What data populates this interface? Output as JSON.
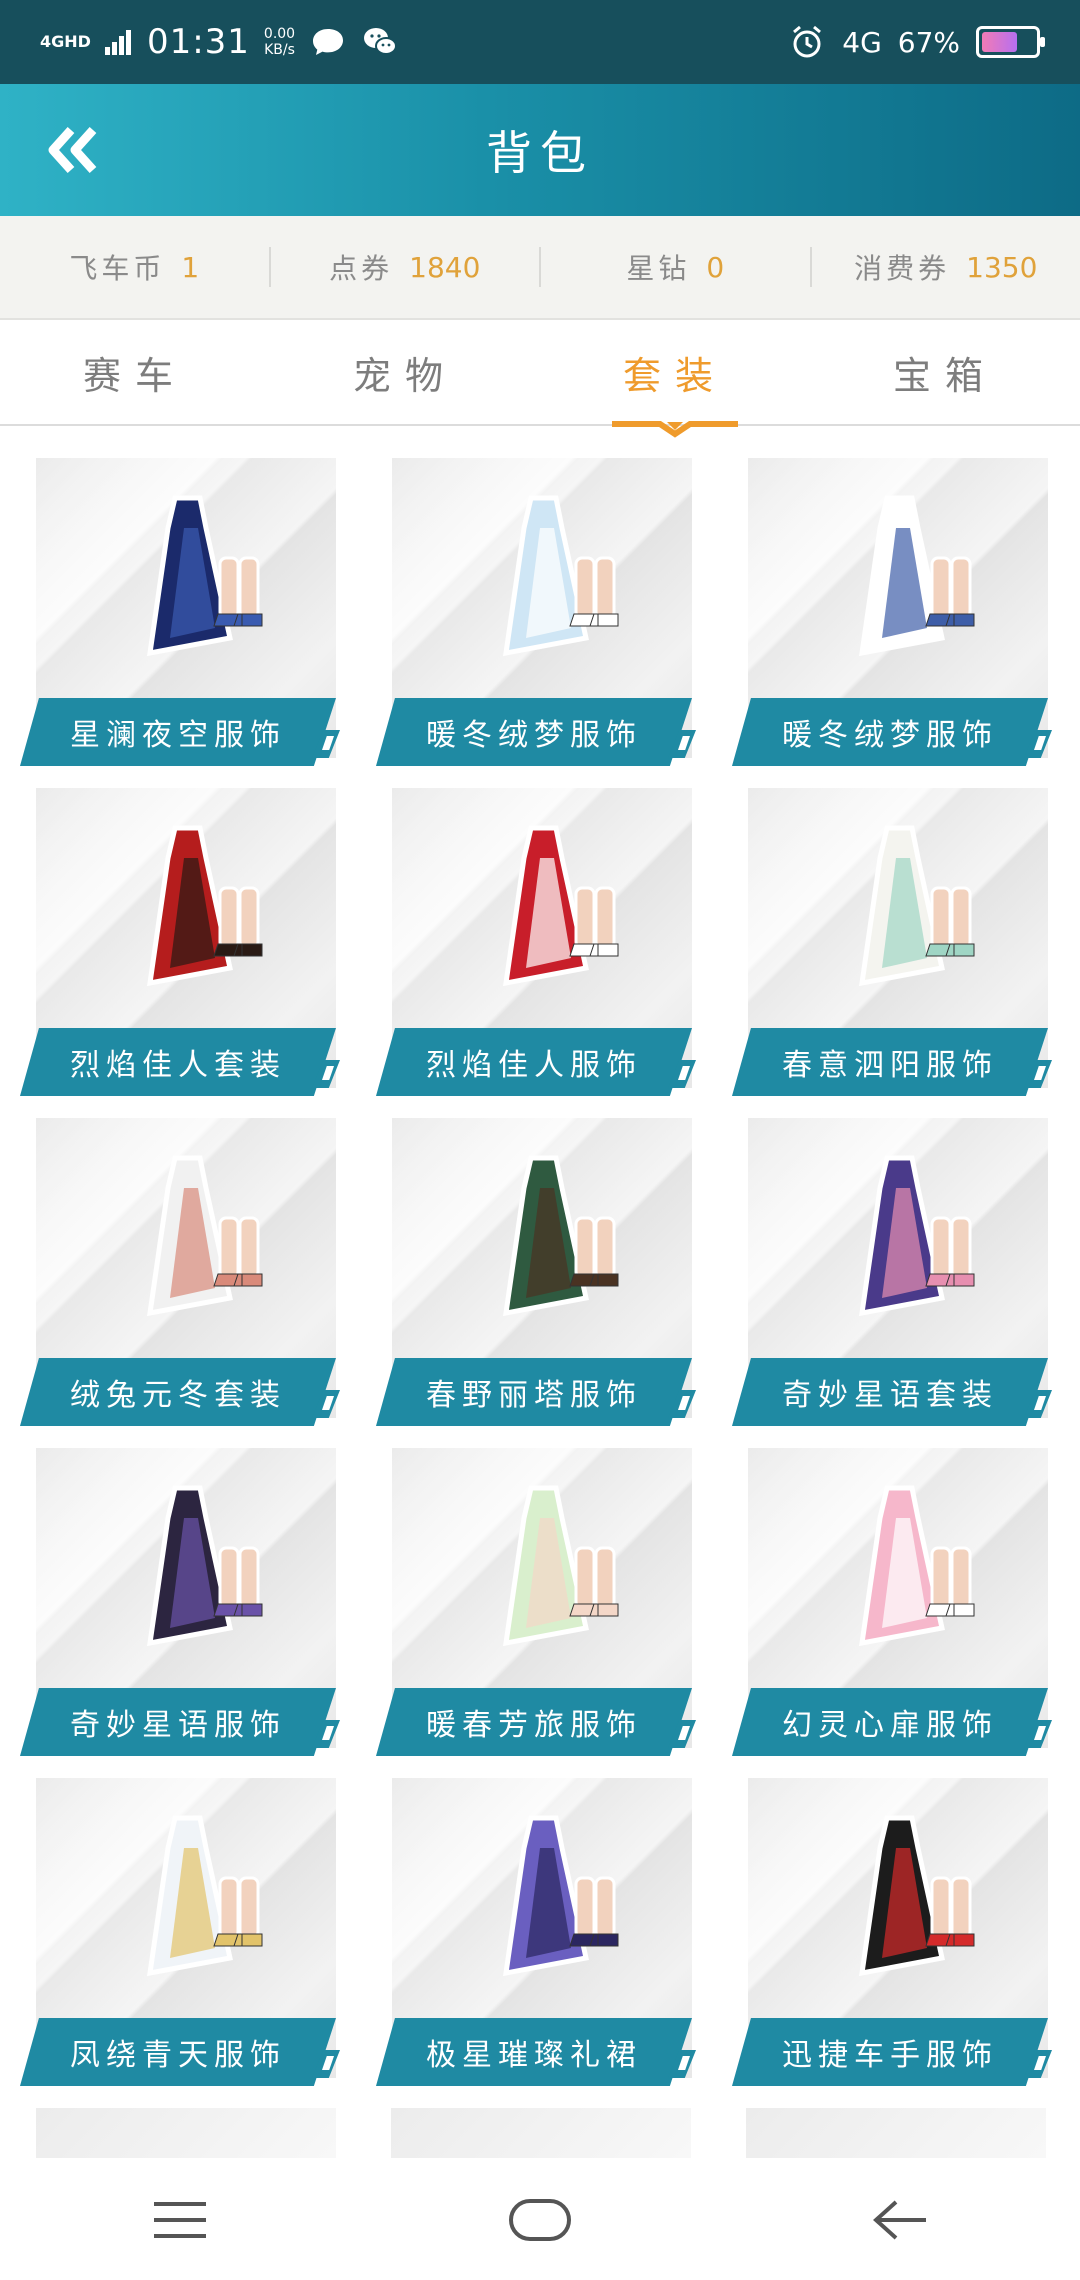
{
  "status_bar": {
    "network": "4GHD",
    "time": "01:31",
    "speed_value": "0.00",
    "speed_unit": "KB/s",
    "lte": "4G",
    "battery": "67%",
    "battery_level": 0.67
  },
  "header": {
    "title": "背包",
    "back_icon": "double-chevron-left-icon"
  },
  "currency": [
    {
      "label": "飞车币",
      "value": "1"
    },
    {
      "label": "点券",
      "value": "1840"
    },
    {
      "label": "星钻",
      "value": "0"
    },
    {
      "label": "消费券",
      "value": "1350"
    }
  ],
  "tabs": [
    {
      "label": "赛车",
      "active": false
    },
    {
      "label": "宠物",
      "active": false
    },
    {
      "label": "套装",
      "active": true
    },
    {
      "label": "宝箱",
      "active": false
    }
  ],
  "items": [
    {
      "name": "星澜夜空服饰",
      "colors": [
        "#1b2a6b",
        "#3a5bb0"
      ]
    },
    {
      "name": "暖冬绒梦服饰",
      "colors": [
        "#cfe6f5",
        "#ffffff"
      ]
    },
    {
      "name": "暖冬绒梦服饰",
      "colors": [
        "#ffffff",
        "#3e5ea8"
      ]
    },
    {
      "name": "烈焰佳人套装",
      "colors": [
        "#b51d1d",
        "#2a1a14"
      ]
    },
    {
      "name": "烈焰佳人服饰",
      "colors": [
        "#c81e2a",
        "#ffffff"
      ]
    },
    {
      "name": "春意泗阳服饰",
      "colors": [
        "#f4f4ef",
        "#9fd5c4"
      ]
    },
    {
      "name": "绒兔元冬套装",
      "colors": [
        "#f1f1f1",
        "#d98a7a"
      ]
    },
    {
      "name": "春野丽塔服饰",
      "colors": [
        "#2f5a40",
        "#4a3222"
      ]
    },
    {
      "name": "奇妙星语套装",
      "colors": [
        "#4a3a8a",
        "#e78fb0"
      ]
    },
    {
      "name": "奇妙星语服饰",
      "colors": [
        "#2c2540",
        "#6a52a8"
      ]
    },
    {
      "name": "暖春芳旅服饰",
      "colors": [
        "#d9efcd",
        "#f4d7c8"
      ]
    },
    {
      "name": "幻灵心扉服饰",
      "colors": [
        "#f6b7cb",
        "#ffffff"
      ]
    },
    {
      "name": "凤绕青天服饰",
      "colors": [
        "#f0f4f8",
        "#e2c36a"
      ]
    },
    {
      "name": "极星璀璨礼裙",
      "colors": [
        "#6a5fc0",
        "#2b2660"
      ]
    },
    {
      "name": "迅捷车手服饰",
      "colors": [
        "#1c1c1c",
        "#d42a2a"
      ]
    }
  ],
  "navbar": {
    "menu_icon": "menu-icon",
    "home_icon": "home-icon",
    "back_icon": "back-arrow-icon"
  },
  "colors": {
    "status_bg": "#174f5c",
    "accent": "#ef9b2c",
    "teal": "#1f8aa3",
    "currency_value": "#e0a23a"
  }
}
